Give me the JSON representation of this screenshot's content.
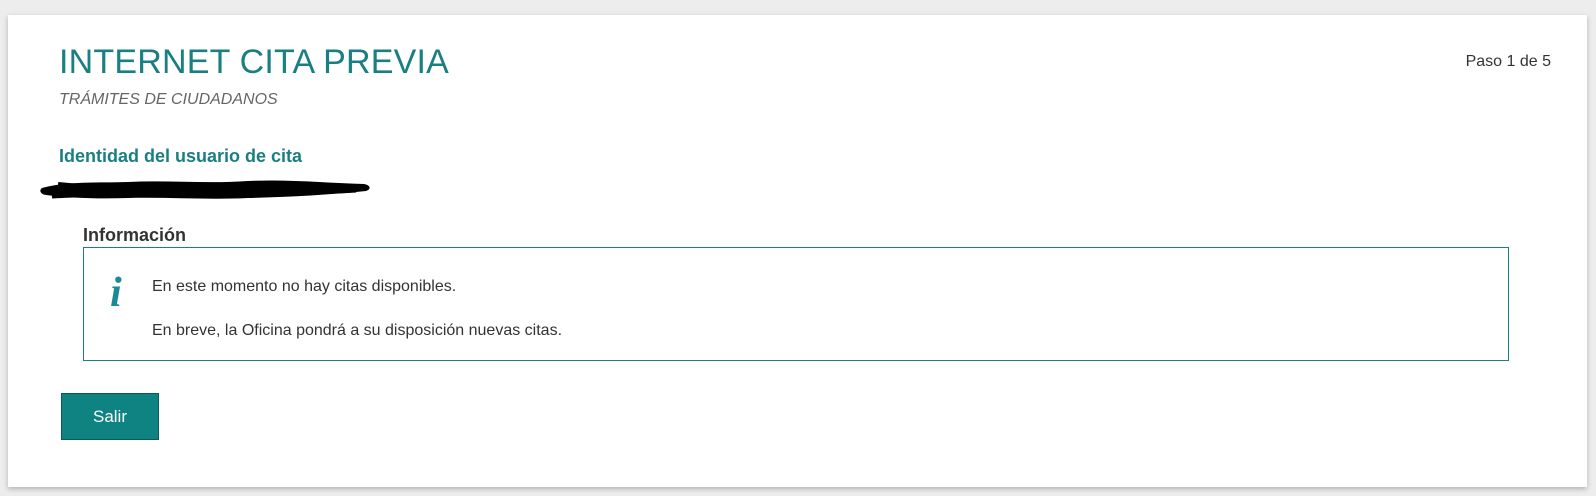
{
  "header": {
    "title": "INTERNET CITA PREVIA",
    "subtitle": "TRÁMITES DE CIUDADANOS",
    "step": "Paso 1 de 5"
  },
  "identity": {
    "heading": "Identidad del usuario de cita"
  },
  "info": {
    "legend": "Información",
    "icon": "info-icon",
    "lines": [
      "En este momento no hay citas disponibles.",
      "En breve, la Oficina pondrá a su disposición nuevas citas."
    ]
  },
  "actions": {
    "exit_label": "Salir"
  },
  "colors": {
    "accent": "#1a7f82",
    "button_bg": "#0f8382",
    "page_bg": "#ededed"
  }
}
